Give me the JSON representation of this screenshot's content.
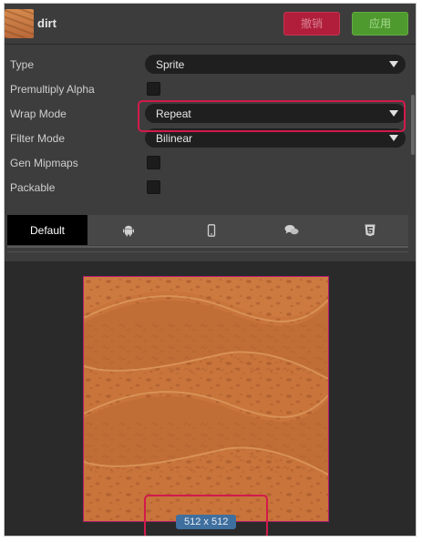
{
  "header": {
    "asset_name": "dirt",
    "cancel_label": "撤销",
    "apply_label": "应用"
  },
  "properties": {
    "type": {
      "label": "Type",
      "value": "Sprite"
    },
    "premultiply_alpha": {
      "label": "Premultiply Alpha",
      "checked": false
    },
    "wrap_mode": {
      "label": "Wrap Mode",
      "value": "Repeat"
    },
    "filter_mode": {
      "label": "Filter Mode",
      "value": "Bilinear"
    },
    "gen_mipmaps": {
      "label": "Gen Mipmaps",
      "checked": false
    },
    "packable": {
      "label": "Packable",
      "checked": false
    }
  },
  "platform_tabs": {
    "default_label": "Default",
    "icons": [
      "android-icon",
      "mobile-phone-icon",
      "chat-bubbles-icon",
      "html5-icon"
    ]
  },
  "preview": {
    "size_label": "512 x 512"
  },
  "colors": {
    "highlight": "#d21a4c",
    "cancel": "#b01e3c",
    "apply": "#4e9a2e",
    "badge": "#3f6f9f"
  }
}
